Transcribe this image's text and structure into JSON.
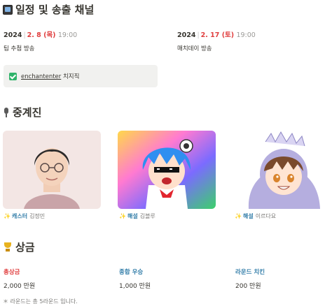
{
  "schedule": {
    "title": "일정 및 송출 채널",
    "events": [
      {
        "year": "2024",
        "date": "2. 8 (목)",
        "time": "19:00",
        "name": "팀 추첨 방송"
      },
      {
        "year": "2024",
        "date": "2. 17 (토)",
        "time": "19:00",
        "name": "매치데이 방송"
      }
    ],
    "callout": {
      "channel": "enchantenter",
      "suffix": "치지직"
    }
  },
  "casters": {
    "title": "중계진",
    "items": [
      {
        "role": "캐스터",
        "name": "김정민"
      },
      {
        "role": "해설",
        "name": "김블루"
      },
      {
        "role": "해설",
        "name": "이르다요"
      }
    ]
  },
  "prizes": {
    "title": "상금",
    "items": [
      {
        "label": "총상금",
        "value": "2,000 만원",
        "color": "#e03e3e"
      },
      {
        "label": "종합 우승",
        "value": "1,000 만원",
        "color": "#337ea9"
      },
      {
        "label": "라운드 치킨",
        "value": "200 만원",
        "color": "#337ea9"
      }
    ],
    "note": "라운드는 총 5라운드 입니다."
  },
  "icons": {
    "schedule": "tv-icon",
    "casters": "microphone-icon",
    "prizes": "trophy-icon",
    "callout": "check-icon",
    "caption": "sparkle-icon"
  }
}
